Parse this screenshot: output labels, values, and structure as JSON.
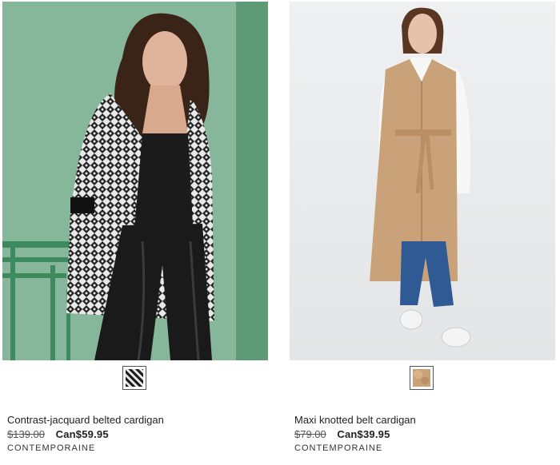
{
  "products": [
    {
      "title": "Contrast-jacquard belted cardigan",
      "old_price": "$139.00",
      "new_price": "Can$59.95",
      "brand": "CONTEMPORAINE"
    },
    {
      "title": "Maxi knotted belt cardigan",
      "old_price": "$79.00",
      "new_price": "Can$39.95",
      "brand": "CONTEMPORAINE"
    }
  ]
}
